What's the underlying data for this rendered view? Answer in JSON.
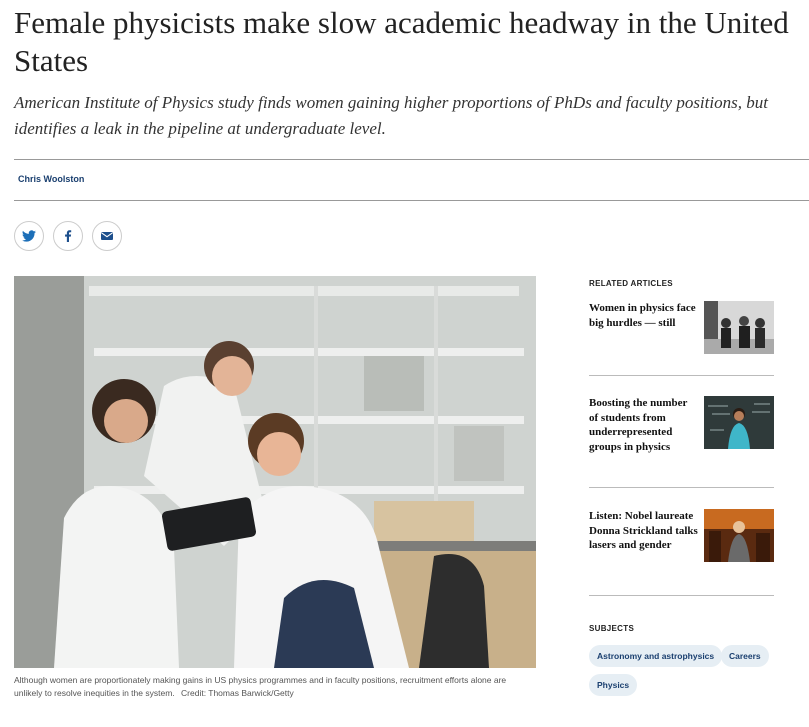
{
  "article": {
    "title": "Female physicists make slow academic headway in the United States",
    "standfirst": "American Institute of Physics study finds women gaining higher proportions of PhDs and faculty positions, but identifies a leak in the pipeline at undergraduate level.",
    "author": "Chris Woolston"
  },
  "share": {
    "icons": [
      "twitter-icon",
      "facebook-icon",
      "email-icon"
    ],
    "twitter_color": "#1d6fb8",
    "facebook_color": "#1d4f8c",
    "email_color": "#1d4f8c"
  },
  "figure": {
    "caption": "Although women are proportionately making gains in US physics programmes and in faculty positions, recruitment efforts alone are unlikely to resolve inequities in the system.",
    "credit": "Credit: Thomas Barwick/Getty"
  },
  "related": {
    "heading": "RELATED ARTICLES",
    "items": [
      {
        "title": "Women in physics face big hurdles — still"
      },
      {
        "title": "Boosting the number of students from underrepresented groups in physics"
      },
      {
        "title": "Listen: Nobel laureate Donna Strickland talks lasers and gender"
      }
    ]
  },
  "subjects": {
    "heading": "SUBJECTS",
    "tags": [
      "Astronomy and astrophysics",
      "Careers",
      "Physics"
    ]
  },
  "colors": {
    "link_blue": "#1a3f6f",
    "tag_background": "#e6eef4"
  }
}
